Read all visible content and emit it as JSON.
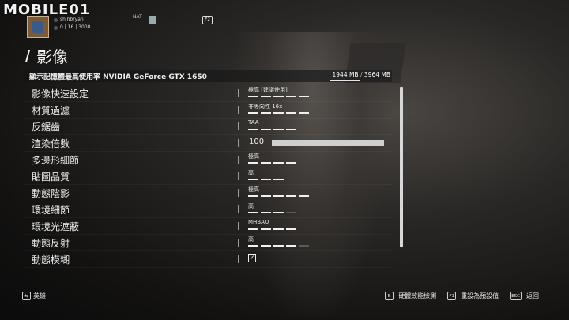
{
  "watermark": {
    "text": "MOBILE01"
  },
  "profile": {
    "username": "shihbryan",
    "stats": "0 | 16 | 3000"
  },
  "topbar": {
    "nat_label": "NAT",
    "f2_key": "F2"
  },
  "page": {
    "title": "影像"
  },
  "vram": {
    "label": "顯示記憶體最高使用率 NVIDIA GeForce GTX 1650",
    "used": "1944 MB",
    "separator": "/",
    "total": "3964 MB",
    "usage_fraction": 0.49
  },
  "settings": [
    {
      "label": "影像快速設定",
      "value": "極高 [建議使用]",
      "segments": 5,
      "level": 5
    },
    {
      "label": "材質過濾",
      "value": "非等向性 16x",
      "segments": 5,
      "level": 5
    },
    {
      "label": "反鋸齒",
      "value": "TAA",
      "segments": 4,
      "level": 4
    },
    {
      "label": "渲染倍數",
      "slider_value": "100"
    },
    {
      "label": "多邊形細節",
      "value": "極高",
      "segments": 4,
      "level": 4
    },
    {
      "label": "貼圖品質",
      "value": "高",
      "segments": 3,
      "level": 3
    },
    {
      "label": "動態陰影",
      "value": "極高",
      "segments": 5,
      "level": 5
    },
    {
      "label": "環境細節",
      "value": "高",
      "segments": 4,
      "level": 3
    },
    {
      "label": "環境光遮蔽",
      "value": "MHBAO",
      "segments": 4,
      "level": 4
    },
    {
      "label": "動態反射",
      "value": "高",
      "segments": 5,
      "level": 4
    },
    {
      "label": "動態模糊",
      "checkbox": "✓"
    }
  ],
  "footer": {
    "hero_label": "英雄",
    "actions": [
      {
        "key": "B",
        "label": "硬體效能檢測"
      },
      {
        "key": "F1",
        "label": "重設為預設值"
      },
      {
        "key": "ESC",
        "label": "返回"
      }
    ]
  }
}
